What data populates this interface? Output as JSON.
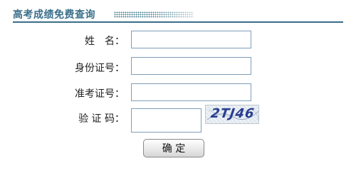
{
  "header": {
    "title": "高考成绩免费查询"
  },
  "form": {
    "name_label": "姓　名：",
    "id_label": "身份证号：",
    "exam_label": "准考证号：",
    "captcha_label": "验 证 码：",
    "name_value": "",
    "id_value": "",
    "exam_value": "",
    "captcha_value": ""
  },
  "captcha": {
    "text": "2TJ46"
  },
  "actions": {
    "submit_label": "确 定"
  },
  "colors": {
    "accent": "#3a6f8a",
    "input_border": "#7f9db9"
  }
}
